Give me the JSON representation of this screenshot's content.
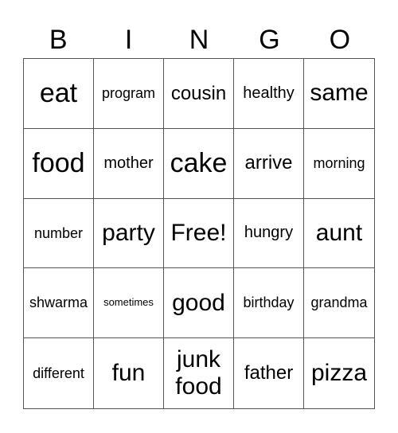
{
  "header": [
    "B",
    "I",
    "N",
    "G",
    "O"
  ],
  "cells": [
    [
      "eat",
      "program",
      "cousin",
      "healthy",
      "same"
    ],
    [
      "food",
      "mother",
      "cake",
      "arrive",
      "morning"
    ],
    [
      "number",
      "party",
      "Free!",
      "hungry",
      "aunt"
    ],
    [
      "shwarma",
      "sometimes",
      "good",
      "birthday",
      "grandma"
    ],
    [
      "different",
      "fun",
      "junk food",
      "father",
      "pizza"
    ]
  ]
}
